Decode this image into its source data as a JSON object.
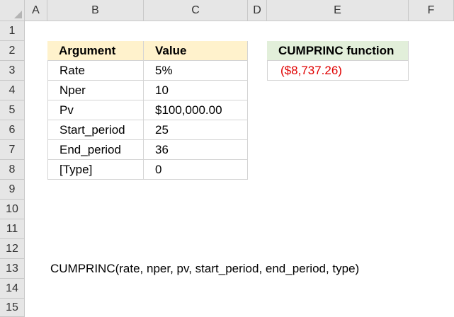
{
  "columns": [
    "A",
    "B",
    "C",
    "D",
    "E",
    "F"
  ],
  "rows": [
    "1",
    "2",
    "3",
    "4",
    "5",
    "6",
    "7",
    "8",
    "9",
    "10",
    "11",
    "12",
    "13",
    "14",
    "15"
  ],
  "table": {
    "headers": [
      "Argument",
      "Value"
    ],
    "rows": [
      [
        "Rate",
        "5%"
      ],
      [
        "Nper",
        "10"
      ],
      [
        "Pv",
        "$100,000.00"
      ],
      [
        "Start_period",
        "25"
      ],
      [
        "End_period",
        "36"
      ],
      [
        "[Type]",
        "0"
      ]
    ]
  },
  "result": {
    "header": "CUMPRINC function",
    "value": "($8,737.26)"
  },
  "syntax_text": "CUMPRINC(rate, nper, pv, start_period, end_period, type)",
  "colors": {
    "header_yellow": "#fff2cc",
    "header_green": "#e2efda",
    "negative_red": "#e00000"
  }
}
